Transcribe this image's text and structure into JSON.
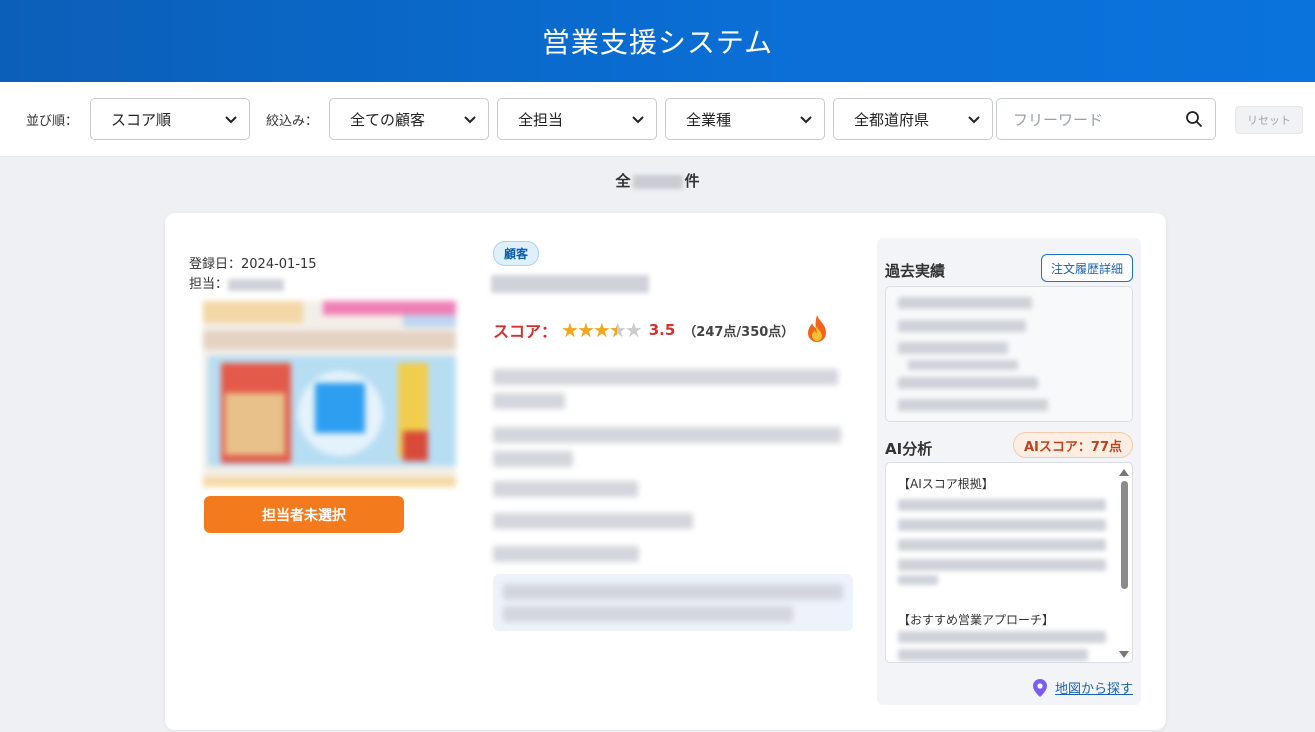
{
  "app": {
    "title": "営業支援システム"
  },
  "toolbar": {
    "sort_label": "並び順：",
    "sort_value": "スコア順",
    "filter_label": "絞込み：",
    "filter_customer": "全ての顧客",
    "filter_owner": "全担当",
    "filter_industry": "全業種",
    "filter_prefecture": "全都道府県",
    "search_placeholder": "フリーワード",
    "reset_label": "リセット"
  },
  "results": {
    "prefix": "全",
    "suffix": "件"
  },
  "card": {
    "registered": "登録日：2024-01-15",
    "owner_label": "担当：",
    "assign_button": "担当者未選択",
    "badge": "顧客",
    "score_label": "スコア：",
    "stars_value": 3.5,
    "score_value": "3.5",
    "score_detail": "（247点/350点）",
    "past_title": "過去実績",
    "order_history_button": "注文履歴詳細",
    "ai_title": "AI分析",
    "ai_score": "AIスコア：77点",
    "ai_section1": "【AIスコア根拠】",
    "ai_section2": "【おすすめ営業アプローチ】",
    "map_link": "地図から探す"
  },
  "colors": {
    "header": "#0b6cd0",
    "accent_orange": "#f47b1d",
    "score_red": "#d4302f",
    "star": "#f2a71c"
  }
}
